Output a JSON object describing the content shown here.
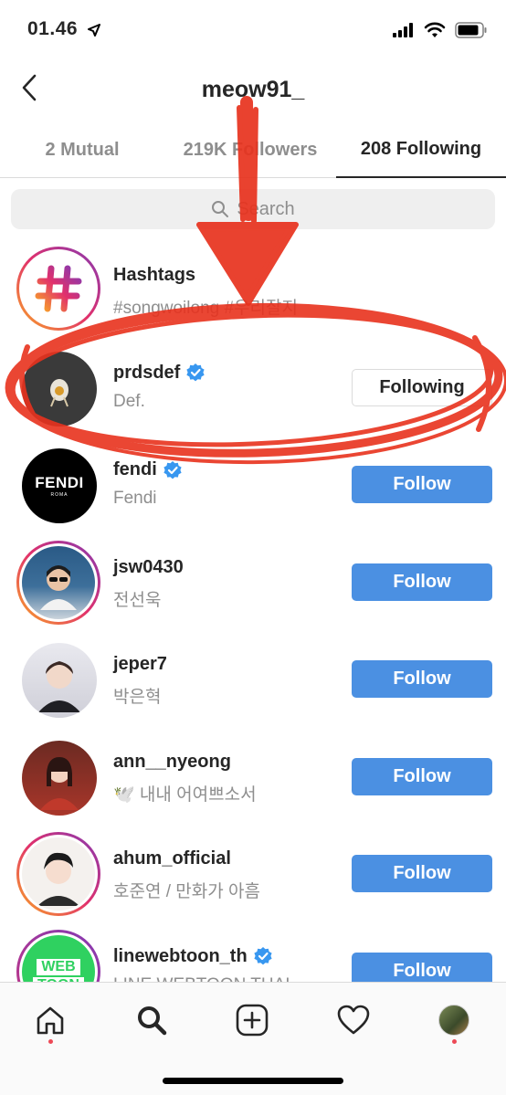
{
  "status_bar": {
    "time": "01.46"
  },
  "header": {
    "title": "meow91_"
  },
  "tabs": [
    {
      "label": "2 Mutual"
    },
    {
      "label": "219K Followers"
    },
    {
      "label": "208 Following"
    }
  ],
  "search": {
    "placeholder": "Search"
  },
  "rows": [
    {
      "name": "Hashtags",
      "sub": "#songwoilong #우리잘지",
      "verified": false,
      "button": ""
    },
    {
      "name": "prdsdef",
      "sub": "Def.",
      "verified": true,
      "button": "Following"
    },
    {
      "name": "fendi",
      "sub": "Fendi",
      "verified": true,
      "button": "Follow"
    },
    {
      "name": "jsw0430",
      "sub": "전선욱",
      "verified": false,
      "button": "Follow"
    },
    {
      "name": "jeper7",
      "sub": "박은혁",
      "verified": false,
      "button": "Follow"
    },
    {
      "name": "ann__nyeong",
      "sub": "🕊️ 내내 어여쁘소서",
      "verified": false,
      "button": "Follow"
    },
    {
      "name": "ahum_official",
      "sub": "호준연 / 만화가 아흠",
      "verified": false,
      "button": "Follow"
    },
    {
      "name": "linewebtoon_th",
      "sub": "LINE WEBTOON THAI",
      "verified": true,
      "button": "Follow"
    }
  ],
  "avatars": {
    "fendi_logo": "FENDI",
    "fendi_sub": "ROMA",
    "webtoon_top": "WEB",
    "webtoon_bottom": "TOON"
  },
  "icons": [
    "back-icon",
    "search-icon",
    "verified-badge-icon",
    "home-icon",
    "explore-icon",
    "new-post-icon",
    "activity-icon"
  ],
  "colors": {
    "follow_blue": "#4b90e2",
    "annotation_red": "#e8321e",
    "verified_blue": "#3897f0"
  }
}
